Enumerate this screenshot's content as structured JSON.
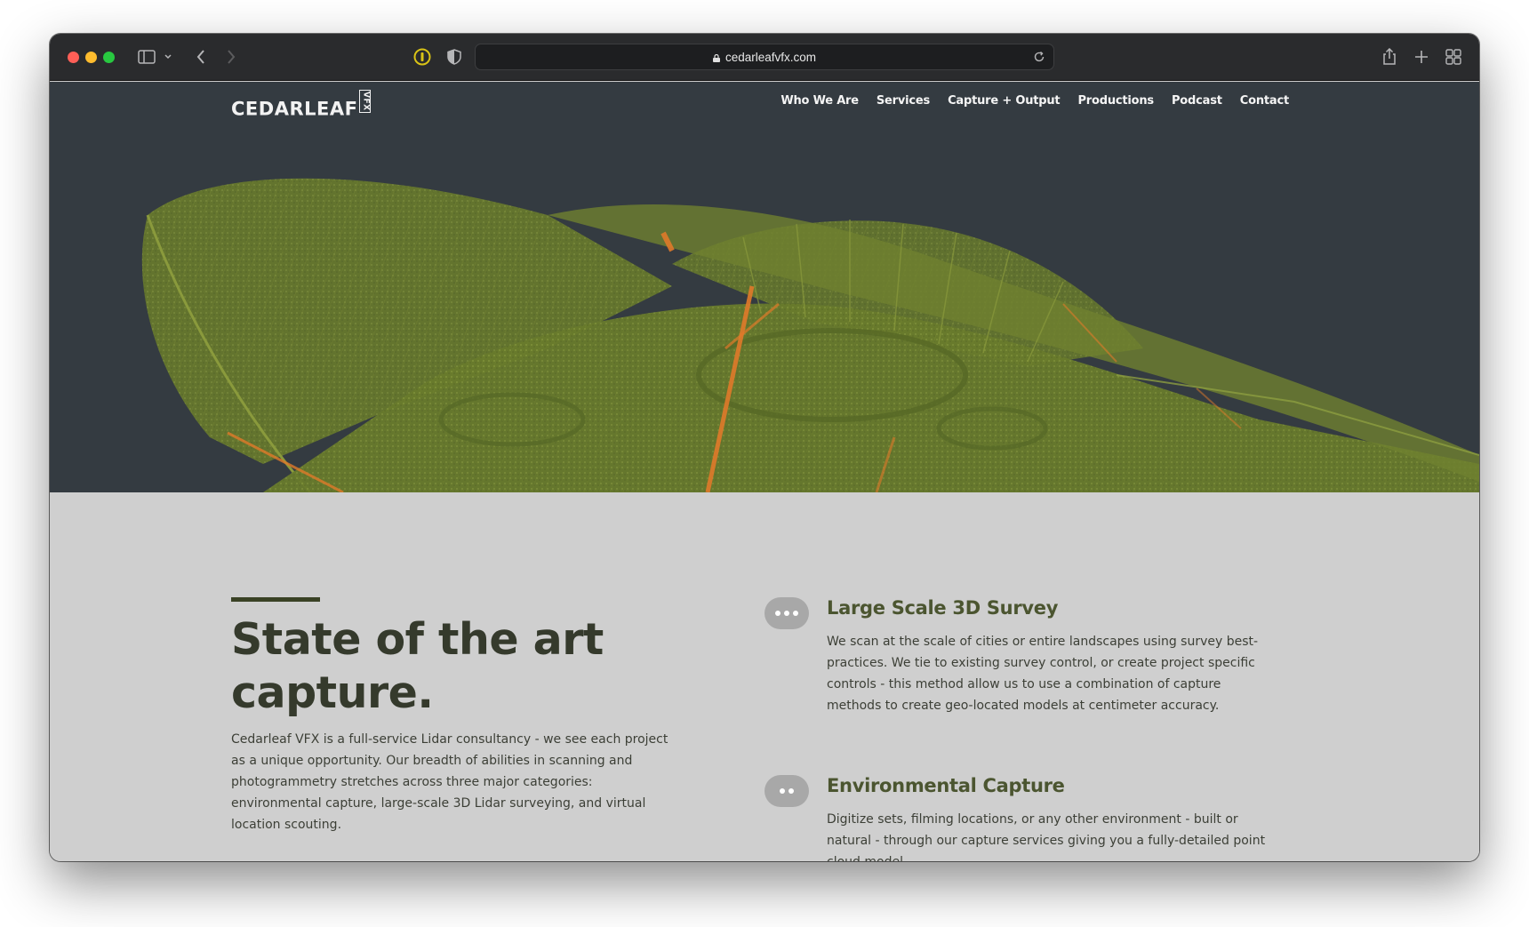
{
  "browser": {
    "url": "cedarleafvfx.com",
    "icons": {
      "sidebar": "sidebar-icon",
      "back": "chevron-left-icon",
      "forward": "chevron-right-icon",
      "password_manager": "onepassword-icon",
      "privacy": "shield-icon",
      "reload": "reload-icon",
      "share": "share-icon",
      "new_tab": "plus-icon",
      "tab_overview": "grid-icon"
    }
  },
  "site": {
    "logo_text": "CEDARLEAF",
    "logo_badge": "VFX",
    "nav": [
      {
        "label": "Who We Are"
      },
      {
        "label": "Services"
      },
      {
        "label": "Capture + Output"
      },
      {
        "label": "Productions"
      },
      {
        "label": "Podcast"
      },
      {
        "label": "Contact"
      }
    ]
  },
  "intro": {
    "heading": "State of the art capture.",
    "body": "Cedarleaf VFX is a full-service Lidar consultancy - we see each project as a unique opportunity. Our breadth of abilities in scanning and photogrammetry stretches across three major categories: environmental capture, large-scale 3D Lidar surveying, and virtual location scouting."
  },
  "features": [
    {
      "title": "Large Scale 3D Survey",
      "body": "We scan at the scale of cities or entire landscapes using survey best-practices. We tie to existing survey control, or create project specific controls - this method allow us to use a combination of capture methods to create geo-located models at centimeter accuracy.",
      "dots": 3
    },
    {
      "title": "Environmental Capture",
      "body": "Digitize sets, filming locations, or any other environment - built or natural - through our capture services giving you a fully-detailed point cloud model.",
      "dots": 2
    }
  ],
  "colors": {
    "hero_bg": "#343b41",
    "point_cloud": "#6b7a2e",
    "accent_orange": "#e07a2a",
    "content_bg": "#cfcfcf",
    "heading": "#353a2c",
    "feature_title": "#4b5530"
  }
}
